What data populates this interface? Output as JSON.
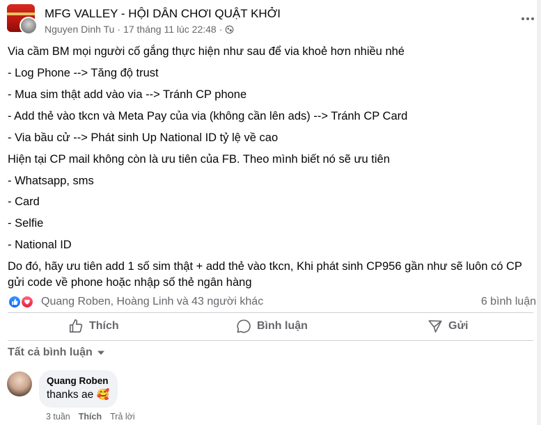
{
  "post": {
    "group_name": "MFG VALLEY - HỘI DÂN CHƠI QUẬT KHỞI",
    "author": "Nguyen Dinh Tu",
    "separator": "·",
    "timestamp": "17 tháng 11 lúc 22:48",
    "audience_icon": "globe-icon",
    "more_icon": "more-icon",
    "body_lines": [
      "Via cầm BM mọi người cố gắng thực hiện như sau để via khoẻ hơn nhiều nhé",
      "- Log Phone --> Tăng độ trust",
      "- Mua sim thật add vào via --> Tránh CP phone",
      "- Add thẻ vào tkcn và Meta Pay của via (không cần lên ads) --> Tránh CP Card",
      "- Via bầu cử --> Phát sinh Up National ID tỷ lệ về cao",
      "Hiện tại CP mail không còn là ưu tiên của FB. Theo mình biết nó sẽ ưu tiên",
      "- Whatsapp, sms",
      "- Card",
      "- Selfie",
      "- National ID",
      "Do đó, hãy ưu tiên add 1 số sim thật + add thẻ vào tkcn, Khi phát sinh CP956 gần như sẽ luôn có CP",
      "gửi code về phone hoặc nhập số thẻ ngân hàng"
    ]
  },
  "reactions": {
    "names": "Quang Roben, Hoàng Linh và 43 người khác",
    "comment_count": "6 bình luận",
    "like_color": "#0866ff",
    "love_color": "#e61e3c"
  },
  "actions": {
    "like": "Thích",
    "comment": "Bình luận",
    "share": "Gửi"
  },
  "comments_filter": "Tất cả bình luận",
  "comment": {
    "author": "Quang Roben",
    "text": "thanks ae",
    "emoji": "🥰",
    "time": "3 tuần",
    "like": "Thích",
    "reply": "Trả lời"
  }
}
